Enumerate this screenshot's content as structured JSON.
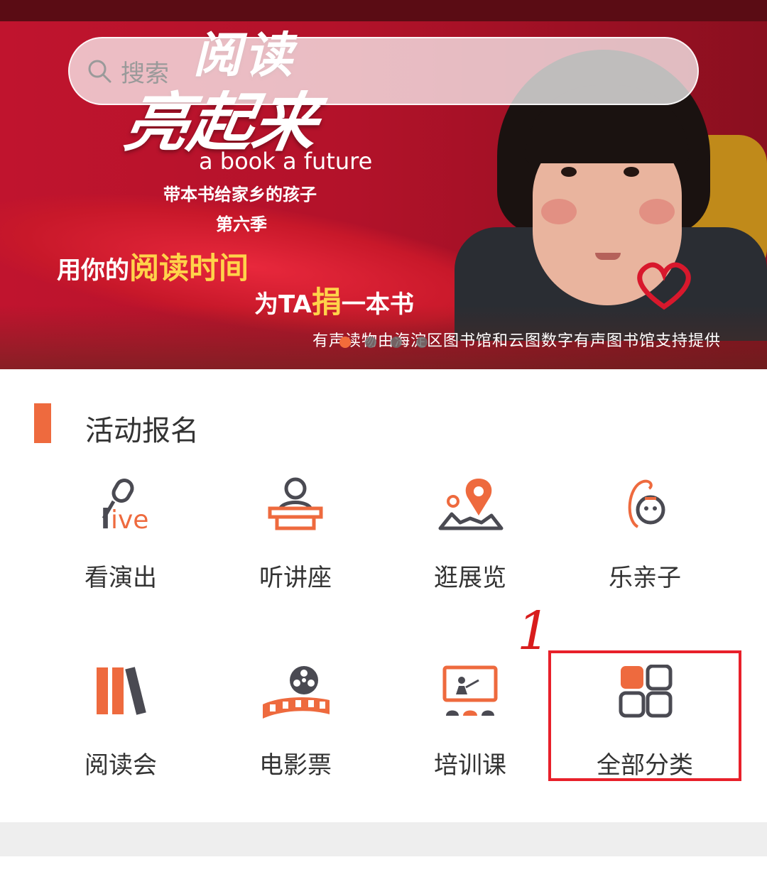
{
  "banner": {
    "search_placeholder": "搜索",
    "title_line1": "阅读",
    "title_line2": "亮起来",
    "english": "a book a future",
    "subtitle1": "带本书给家乡的孩子",
    "subtitle2": "第六季",
    "slogan1_pre": "用你的",
    "slogan1_hl": "阅读时间",
    "slogan2_pre": "为TA",
    "slogan2_hl": "捐",
    "slogan2_post": "一本书",
    "credit": "有声读物由海淀区图书馆和云图数字有声图书馆支持提供",
    "active_dot": 0
  },
  "section": {
    "title": "活动报名"
  },
  "categories": [
    {
      "label": "看演出",
      "icon": "live-microphone-icon"
    },
    {
      "label": "听讲座",
      "icon": "lecture-podium-icon"
    },
    {
      "label": "逛展览",
      "icon": "map-pin-icon"
    },
    {
      "label": "乐亲子",
      "icon": "baby-icon"
    },
    {
      "label": "阅读会",
      "icon": "books-icon"
    },
    {
      "label": "电影票",
      "icon": "film-reel-icon"
    },
    {
      "label": "培训课",
      "icon": "training-board-icon"
    },
    {
      "label": "全部分类",
      "icon": "grid-icon"
    }
  ],
  "annotation": {
    "label": "1"
  },
  "colors": {
    "accent": "#ee6a3e",
    "icon_dark": "#4a4a52",
    "highlight": "#e8202a"
  }
}
